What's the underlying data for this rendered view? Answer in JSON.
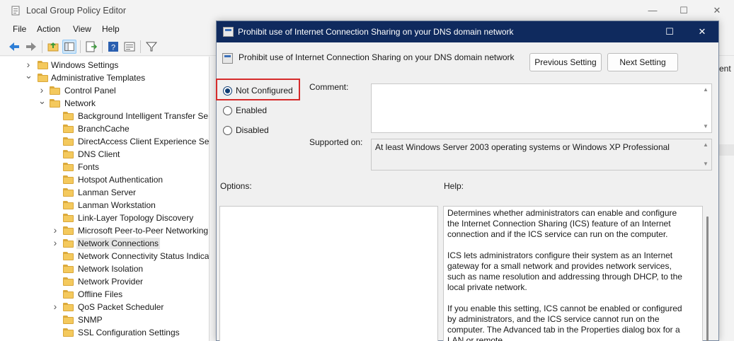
{
  "main": {
    "title": "Local Group Policy Editor",
    "menu": [
      "File",
      "Action",
      "View",
      "Help"
    ],
    "controls": {
      "minimize": "—",
      "maximize": "☐",
      "close": "✕"
    }
  },
  "tree": [
    {
      "label": "Windows Settings",
      "level": 1,
      "chevron": "right"
    },
    {
      "label": "Administrative Templates",
      "level": 1,
      "chevron": "down"
    },
    {
      "label": "Control Panel",
      "level": 2,
      "chevron": "right"
    },
    {
      "label": "Network",
      "level": 2,
      "chevron": "down"
    },
    {
      "label": "Background Intelligent Transfer Ser",
      "level": 3,
      "chevron": ""
    },
    {
      "label": "BranchCache",
      "level": 3,
      "chevron": ""
    },
    {
      "label": "DirectAccess Client Experience Sett",
      "level": 3,
      "chevron": ""
    },
    {
      "label": "DNS Client",
      "level": 3,
      "chevron": ""
    },
    {
      "label": "Fonts",
      "level": 3,
      "chevron": ""
    },
    {
      "label": "Hotspot Authentication",
      "level": 3,
      "chevron": ""
    },
    {
      "label": "Lanman Server",
      "level": 3,
      "chevron": ""
    },
    {
      "label": "Lanman Workstation",
      "level": 3,
      "chevron": ""
    },
    {
      "label": "Link-Layer Topology Discovery",
      "level": 3,
      "chevron": ""
    },
    {
      "label": "Microsoft Peer-to-Peer Networking",
      "level": 3,
      "chevron": "right"
    },
    {
      "label": "Network Connections",
      "level": 3,
      "chevron": "right",
      "selected": true
    },
    {
      "label": "Network Connectivity Status Indica",
      "level": 3,
      "chevron": ""
    },
    {
      "label": "Network Isolation",
      "level": 3,
      "chevron": ""
    },
    {
      "label": "Network Provider",
      "level": 3,
      "chevron": ""
    },
    {
      "label": "Offline Files",
      "level": 3,
      "chevron": ""
    },
    {
      "label": "QoS Packet Scheduler",
      "level": 3,
      "chevron": "right"
    },
    {
      "label": "SNMP",
      "level": 3,
      "chevron": ""
    },
    {
      "label": "SSL Configuration Settings",
      "level": 3,
      "chevron": ""
    }
  ],
  "right_pane": {
    "partial_text": "ent"
  },
  "dialog": {
    "title": "Prohibit use of Internet Connection Sharing on your DNS domain network",
    "setting_name": "Prohibit use of Internet Connection Sharing on your DNS domain network",
    "previous_label": "Previous Setting",
    "next_label": "Next Setting",
    "controls": {
      "maximize": "☐",
      "close": "✕"
    },
    "radios": [
      {
        "label": "Not Configured",
        "checked": true
      },
      {
        "label": "Enabled",
        "checked": false
      },
      {
        "label": "Disabled",
        "checked": false
      }
    ],
    "comment_label": "Comment:",
    "comment_value": "",
    "supported_label": "Supported on:",
    "supported_value": "At least Windows Server 2003 operating systems or Windows XP Professional",
    "options_label": "Options:",
    "help_label": "Help:",
    "help_paragraphs": [
      "Determines whether administrators can enable and configure the Internet Connection Sharing (ICS) feature of an Internet connection and if the ICS service can run on the computer.",
      "ICS lets administrators configure their system as an Internet gateway for a small network and provides network services, such as name resolution and addressing through DHCP, to the local private network.",
      "If you enable this setting, ICS cannot be enabled or configured by administrators, and the ICS service cannot run on the computer. The Advanced tab in the Properties dialog box for a LAN or remote"
    ]
  },
  "colors": {
    "dialog_titlebar": "#0f2a5e",
    "highlight": "#d62b2b",
    "radio_checked": "#0f3d74",
    "folder": "#f4c95d"
  }
}
